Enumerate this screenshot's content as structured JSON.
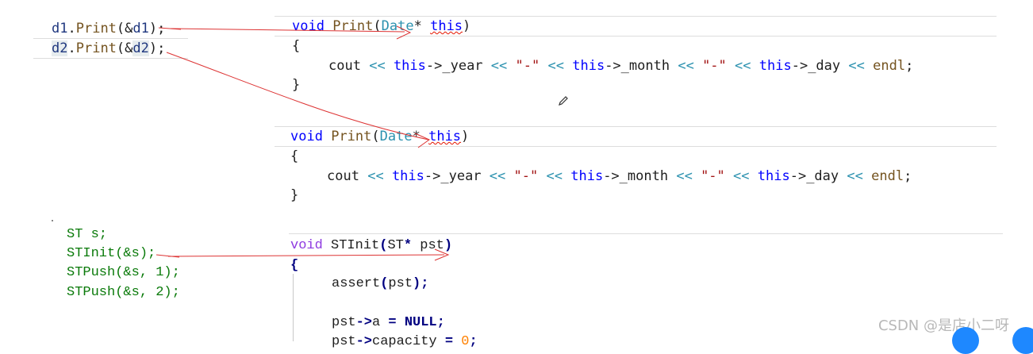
{
  "calls1": {
    "line1": {
      "obj": "d1",
      "method": "Print",
      "arg": "d1"
    },
    "line2": {
      "obj": "d2",
      "method": "Print",
      "arg": "d2"
    }
  },
  "date_print": {
    "signature": {
      "ret": "void",
      "name": "Print",
      "type": "Date",
      "param": "this"
    },
    "open": "{",
    "body": {
      "cout": "cout",
      "ptr": "this",
      "f1": "->_year",
      "sep": "\"-\"",
      "f2": "->_month",
      "f3": "->_day",
      "endl": "endl"
    },
    "close": "}"
  },
  "calls2": {
    "decl": "ST s;",
    "init": "STInit(&s);",
    "push1": "STPush(&s, 1);",
    "push2": "STPush(&s, 2);"
  },
  "stinit": {
    "ret": "void",
    "name": "STInit",
    "type": "ST",
    "param": "pst",
    "open": "{",
    "assert": {
      "fn": "assert",
      "arg": "pst"
    },
    "assign1": {
      "obj": "pst",
      "field": "a",
      "value": "NULL"
    },
    "assign2": {
      "obj": "pst",
      "field": "capacity",
      "value": "0"
    }
  },
  "watermark": "CSDN @是店小二呀"
}
